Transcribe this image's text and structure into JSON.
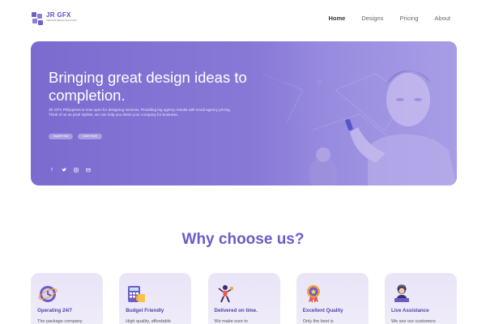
{
  "brand": {
    "name": "JR GFX",
    "tagline": "CREATIVE DESIGN SOLUTIONS"
  },
  "nav": {
    "items": [
      "Home",
      "Designs",
      "Pricing",
      "About"
    ],
    "active": "Home"
  },
  "hero": {
    "title": "Bringing great design ideas to completion.",
    "description": "JR GFX Philippines is now open for designing services. Providing big agency results with small agency pricing. Think of us as pixel stylists, we can help you dress your company for business.",
    "buttons": [
      "Inquire now",
      "Learn more"
    ],
    "social_icons": [
      "facebook-icon",
      "twitter-icon",
      "instagram-icon",
      "email-icon"
    ]
  },
  "why": {
    "title": "Why choose us?"
  },
  "cards": [
    {
      "icon": "clock-icon",
      "title": "Operating 24/7",
      "text": "The package company"
    },
    {
      "icon": "calculator-icon",
      "title": "Budget Friendly",
      "text": "High quality, affordable"
    },
    {
      "icon": "rocket-person-icon",
      "title": "Delivered on time.",
      "text": "We make sure to"
    },
    {
      "icon": "award-medal-icon",
      "title": "Excellent Quality",
      "text": "Only the best is"
    },
    {
      "icon": "support-agent-icon",
      "title": "Live Assistance",
      "text": "We see our customers"
    }
  ],
  "colors": {
    "brand": "#6b5cc8",
    "hero_overlay": "#7b6bd0",
    "card_bg": "#ece8f8"
  }
}
